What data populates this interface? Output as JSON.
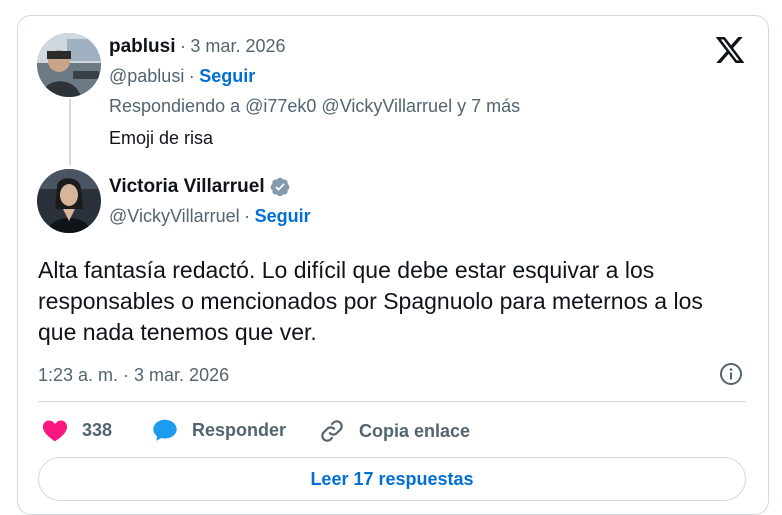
{
  "reply_tweet": {
    "name": "pablusi",
    "separator": "·",
    "date": "3 mar. 2026",
    "handle": "@pablusi",
    "follow_label": "Seguir",
    "replying_to": "Respondiendo a @i77ek0 @VickyVillarruel y 7 más",
    "text": "Emoji de risa"
  },
  "main_tweet": {
    "name": "Victoria Villarruel",
    "verified": true,
    "handle": "@VickyVillarruel",
    "follow_label": "Seguir",
    "text": "Alta fantasía redactó. Lo difícil que debe estar esquivar a los responsables o mencionados por Spagnuolo para meternos a los que nada tenemos que ver.",
    "timestamp": "1:23 a. m. · 3 mar. 2026"
  },
  "actions": {
    "likes_count": "338",
    "reply_label": "Responder",
    "copy_link_label": "Copia enlace"
  },
  "read_replies_label": "Leer 17 respuestas",
  "icons": {
    "brand": "x-logo-icon",
    "info": "info-icon",
    "like": "heart-icon",
    "reply": "speech-bubble-icon",
    "link": "link-icon",
    "verified": "verified-badge-icon"
  },
  "colors": {
    "like": "#f91880",
    "reply_icon": "#1d9bf0",
    "follow": "#006fd6",
    "muted": "#536471"
  }
}
